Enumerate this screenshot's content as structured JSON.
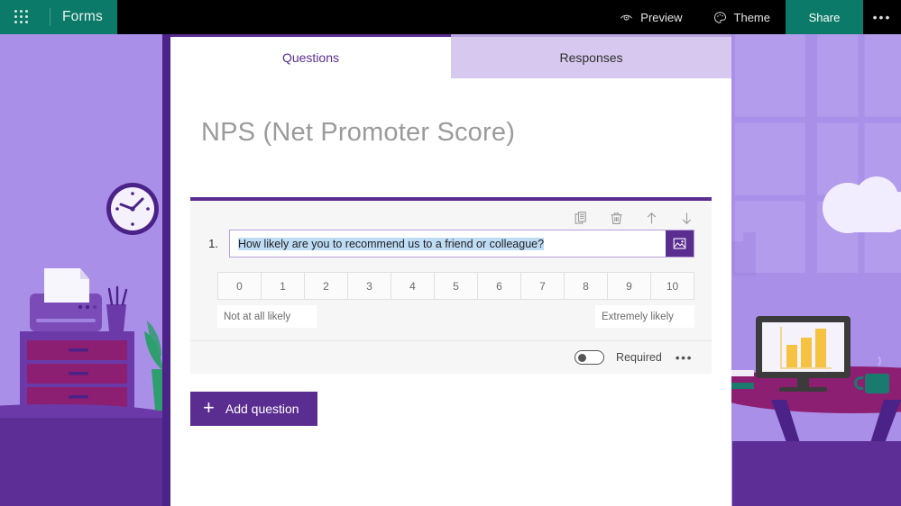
{
  "header": {
    "waffle_icon": "app-launcher-icon",
    "brand": "Forms",
    "preview_label": "Preview",
    "preview_icon": "eye-icon",
    "theme_label": "Theme",
    "theme_icon": "palette-icon",
    "share_label": "Share",
    "more_label": "•••",
    "brand_color": "#0b7a69",
    "bar_color": "#000000"
  },
  "tabs": [
    {
      "label": "Questions",
      "active": true
    },
    {
      "label": "Responses",
      "active": false
    }
  ],
  "form": {
    "title": "NPS (Net Promoter Score)",
    "accent_color": "#5a2d91"
  },
  "question": {
    "number": "1.",
    "text": "How likely are you to recommend us to a friend or colleague?",
    "text_selected": true,
    "image_button_icon": "image-icon",
    "toolbar": [
      {
        "name": "copy-question",
        "icon": "copy-icon"
      },
      {
        "name": "delete-question",
        "icon": "trash-icon"
      },
      {
        "name": "move-question-up",
        "icon": "arrow-up-icon"
      },
      {
        "name": "move-question-down",
        "icon": "arrow-down-icon"
      }
    ],
    "scale": [
      "0",
      "1",
      "2",
      "3",
      "4",
      "5",
      "6",
      "7",
      "8",
      "9",
      "10"
    ],
    "label_low": "Not at all likely",
    "label_high": "Extremely likely",
    "required_label": "Required",
    "required_on": false,
    "more_options": "•••"
  },
  "actions": {
    "add_question": "Add question",
    "add_icon": "plus-icon"
  },
  "theme_colors": {
    "wall": "#a98fe8",
    "floor": "#5d2e96",
    "desk": "#8c1f72",
    "cabinet": "#8c1f72",
    "chart_bar": "#f5c242",
    "mug": "#1b7a6e",
    "plant": "#2f9e6e"
  }
}
